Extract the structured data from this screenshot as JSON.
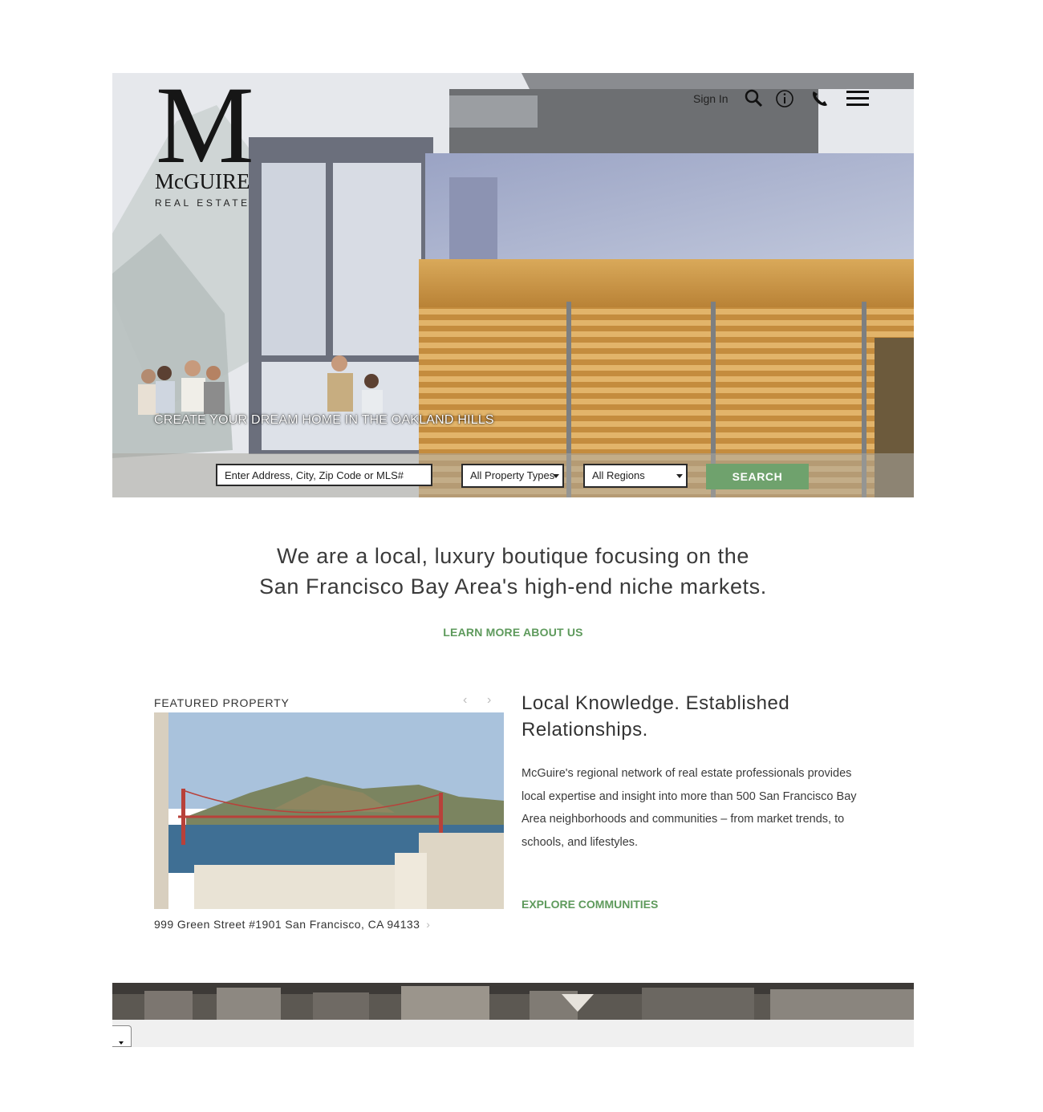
{
  "brand": {
    "logo_letter": "M",
    "logo_name": "McGUIRE",
    "logo_sub": "REAL ESTATE"
  },
  "topnav": {
    "signin_label": "Sign In",
    "icons": [
      "search-icon",
      "info-icon",
      "phone-icon",
      "menu-icon"
    ]
  },
  "hero": {
    "tagline": "CREATE YOUR DREAM HOME IN THE OAKLAND HILLS"
  },
  "search": {
    "placeholder": "Enter Address, City, Zip Code or MLS#",
    "property_type_selected": "All Property Types",
    "region_selected": "All Regions",
    "button_label": "SEARCH"
  },
  "intro": {
    "line1": "We are a local, luxury boutique focusing on the",
    "line2": "San Francisco Bay Area's high-end niche markets.",
    "link_label": "LEARN MORE ABOUT US"
  },
  "featured": {
    "label": "FEATURED PROPERTY",
    "prev_arrow": "‹",
    "next_arrow": "›",
    "address": "999 Green Street #1901 San Francisco, CA 94133",
    "address_chevron": "›"
  },
  "knowledge": {
    "title_line1": "Local Knowledge. Established",
    "title_line2": "Relationships.",
    "body": "McGuire's regional network of real estate professionals provides local expertise and insight into more than 500 San Francisco Bay Area neighborhoods and communities – from market trends, to schools, and lifestyles.",
    "link_label": "EXPLORE COMMUNITIES"
  },
  "colors": {
    "accent_green": "#6fa26d",
    "link_green": "#5e9a5c",
    "text_dark": "#333333"
  }
}
